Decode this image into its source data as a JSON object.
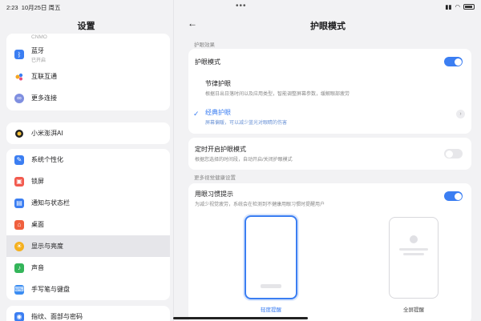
{
  "status": {
    "time": "2:23",
    "date": "10月25日 周五"
  },
  "left": {
    "title": "设置",
    "cnmo": "CNMO",
    "group1": [
      {
        "label": "蓝牙",
        "sub": "已开启",
        "color": "#3b7ef2",
        "icon": "bluetooth-icon"
      },
      {
        "label": "互联互通",
        "sub": "",
        "color": "#ffffff",
        "icon": "interconnect-icon"
      },
      {
        "label": "更多连接",
        "sub": "",
        "color": "#7f8fe0",
        "icon": "link-icon"
      }
    ],
    "ai": {
      "label": "小米澎湃AI",
      "color": "#ffffff",
      "icon": "ai-icon"
    },
    "group2": [
      {
        "label": "系统个性化",
        "color": "#3b7ef2",
        "icon": "brush-icon"
      },
      {
        "label": "锁屏",
        "color": "#f25a4e",
        "icon": "lock-icon"
      },
      {
        "label": "通知与状态栏",
        "color": "#3b7ef2",
        "icon": "notification-icon"
      },
      {
        "label": "桌面",
        "color": "#f0603e",
        "icon": "home-icon"
      },
      {
        "label": "显示与亮度",
        "color": "#f5b01e",
        "icon": "sun-icon"
      },
      {
        "label": "声音",
        "color": "#34b55a",
        "icon": "sound-icon"
      },
      {
        "label": "手写笔与键盘",
        "color": "#3b8df2",
        "icon": "keyboard-icon"
      }
    ],
    "group3": [
      {
        "label": "指纹、面部与密码",
        "color": "#3b7ef2",
        "icon": "fingerprint-icon"
      }
    ]
  },
  "right": {
    "title": "护眼模式",
    "section1": "护眼效果",
    "eye_mode": {
      "title": "护眼模式",
      "on": true
    },
    "rhythm": {
      "title": "节律护眼",
      "desc": "根据日出日落时间以及应用类型，智能调整屏幕参数，缓解眼部疲劳"
    },
    "classic": {
      "title": "经典护眼",
      "desc": "屏幕偏暖，可以减少蓝光对眼睛的伤害"
    },
    "schedule": {
      "title": "定时开启护眼模式",
      "desc": "根据您选择的时间段，自动开启/关闭护眼模式",
      "on": false
    },
    "section2": "更多视觉健康设置",
    "habit": {
      "title": "用眼习惯提示",
      "desc": "为减少视觉疲劳，系统会在检测到不健康用眼习惯时提醒用户",
      "on": true
    },
    "option_light": "轻度提醒",
    "option_full": "全屏提醒"
  }
}
